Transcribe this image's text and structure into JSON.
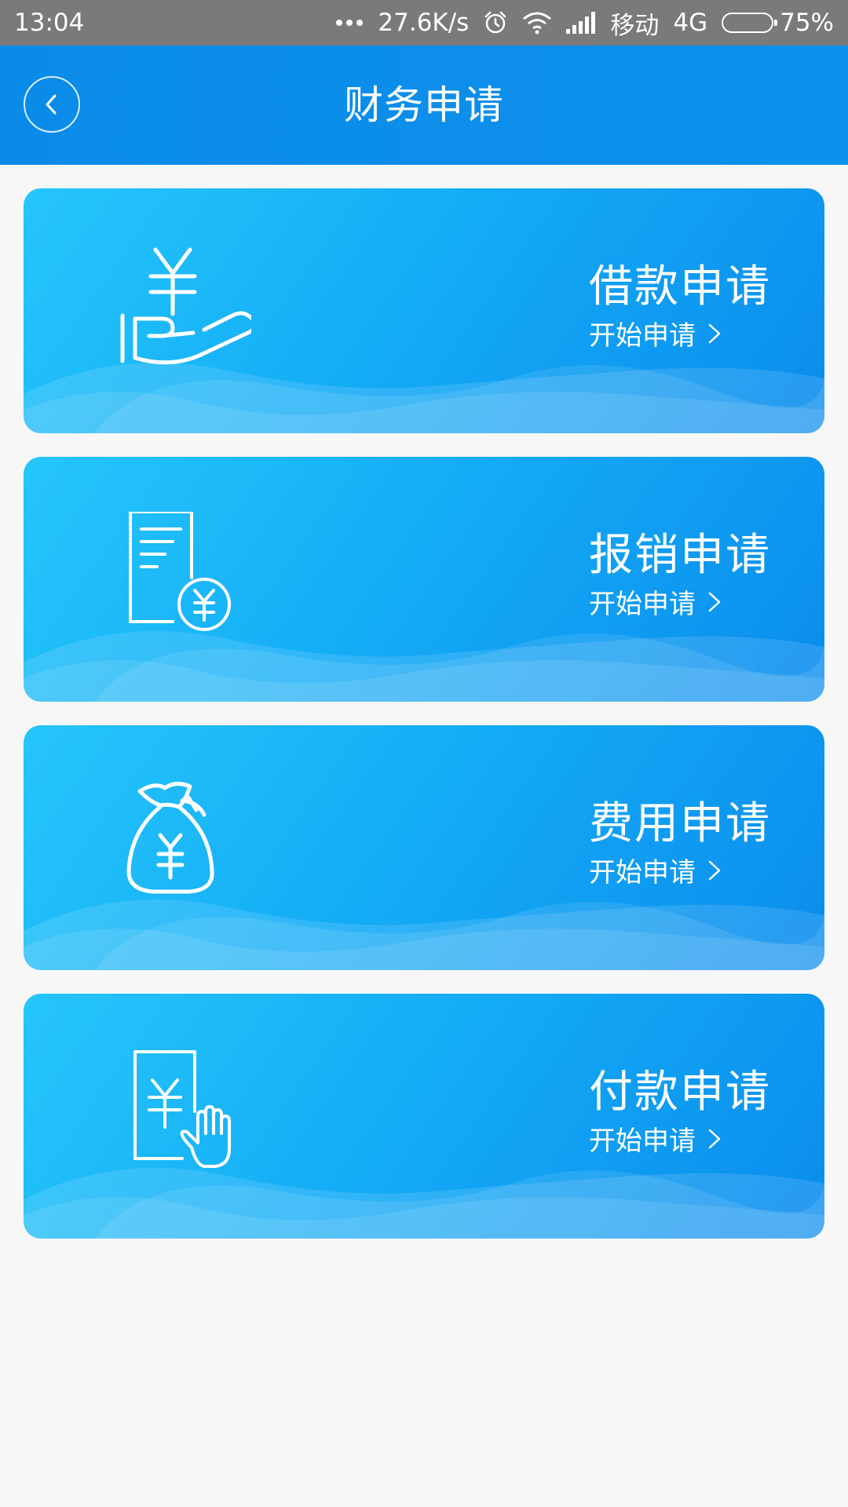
{
  "status_bar": {
    "time": "13:04",
    "speed": "27.6K/s",
    "carrier": "移动",
    "network": "4G",
    "battery_percent": "75%",
    "battery_level": 0.75,
    "icons": [
      "more-dots-icon",
      "alarm-icon",
      "wifi-icon",
      "signal-icon",
      "battery-icon"
    ]
  },
  "header": {
    "title": "财务申请",
    "back_icon": "chevron-left-icon"
  },
  "cards": [
    {
      "title": "借款申请",
      "action": "开始申请",
      "icon": "hand-yuan-icon"
    },
    {
      "title": "报销申请",
      "action": "开始申请",
      "icon": "document-yuan-icon"
    },
    {
      "title": "费用申请",
      "action": "开始申请",
      "icon": "money-bag-icon"
    },
    {
      "title": "付款申请",
      "action": "开始申请",
      "icon": "payment-hand-icon"
    }
  ],
  "colors": {
    "status_bar": "#7a7a7a",
    "header": "#0d8eea",
    "card_light": "#25c6fb",
    "card_dark": "#0a8ced",
    "background": "#f7f7f8"
  }
}
